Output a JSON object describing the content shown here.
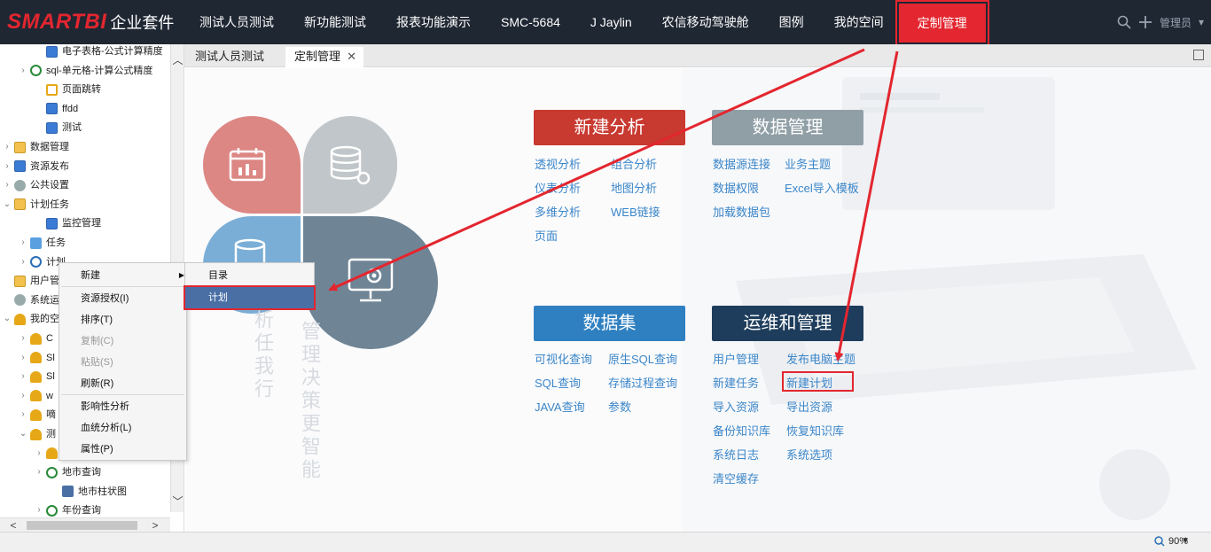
{
  "brand": {
    "name": "SMARTBI",
    "suite": "企业套件"
  },
  "nav": [
    "测试人员测试",
    "新功能测试",
    "报表功能演示",
    "SMC-5684",
    "J Jaylin",
    "农信移动驾驶舱",
    "图例",
    "我的空间",
    "定制管理"
  ],
  "user": {
    "label": "管理员"
  },
  "tree": [
    {
      "label": "电子表格-公式计算精度",
      "icon": "sheet-icon",
      "indent": 2,
      "arrow": ""
    },
    {
      "label": "sql-单元格-计算公式精度",
      "icon": "search-icon",
      "indent": 1,
      "arrow": ">"
    },
    {
      "label": "页面跳转",
      "icon": "page-icon",
      "indent": 2,
      "arrow": ""
    },
    {
      "label": "ffdd",
      "icon": "sheet-icon",
      "indent": 2,
      "arrow": ""
    },
    {
      "label": "测试",
      "icon": "sheet-icon",
      "indent": 2,
      "arrow": ""
    },
    {
      "label": "数据管理",
      "icon": "folder-icon",
      "indent": 0,
      "arrow": ">"
    },
    {
      "label": "资源发布",
      "icon": "sheet-icon",
      "indent": 0,
      "arrow": ">"
    },
    {
      "label": "公共设置",
      "icon": "gear-icon",
      "indent": 0,
      "arrow": ">"
    },
    {
      "label": "计划任务",
      "icon": "folder-icon",
      "indent": 0,
      "arrow": "v"
    },
    {
      "label": "监控管理",
      "icon": "sheet-icon",
      "indent": 2,
      "arrow": ""
    },
    {
      "label": "任务",
      "icon": "task-icon",
      "indent": 1,
      "arrow": ">"
    },
    {
      "label": "计划",
      "icon": "clock-icon",
      "indent": 1,
      "arrow": ">"
    },
    {
      "label": "用户管",
      "icon": "folder-icon",
      "indent": 0,
      "arrow": ""
    },
    {
      "label": "系统运",
      "icon": "gear-icon",
      "indent": 0,
      "arrow": ""
    },
    {
      "label": "我的空",
      "icon": "user-icon",
      "indent": 0,
      "arrow": "v"
    },
    {
      "label": "C",
      "icon": "user-icon",
      "indent": 1,
      "arrow": ">"
    },
    {
      "label": "Sl",
      "icon": "user-icon",
      "indent": 1,
      "arrow": ">"
    },
    {
      "label": "Sl",
      "icon": "user-icon",
      "indent": 1,
      "arrow": ">"
    },
    {
      "label": "w",
      "icon": "user-icon",
      "indent": 1,
      "arrow": ">"
    },
    {
      "label": "嘀",
      "icon": "user-icon",
      "indent": 1,
      "arrow": ">"
    },
    {
      "label": "测",
      "icon": "user-icon",
      "indent": 1,
      "arrow": "v"
    },
    {
      "label": "",
      "icon": "user-icon",
      "indent": 2,
      "arrow": ">"
    },
    {
      "label": "地市查询",
      "icon": "search-icon",
      "indent": 2,
      "arrow": ">"
    },
    {
      "label": "地市柱状图",
      "icon": "chart-icon",
      "indent": 3,
      "arrow": ""
    },
    {
      "label": "年份查询",
      "icon": "search-icon",
      "indent": 2,
      "arrow": ">"
    }
  ],
  "tabs": [
    {
      "label": "测试人员测试"
    },
    {
      "label": "定制管理",
      "close": "✕"
    }
  ],
  "context_menu": {
    "items": [
      "新建",
      "资源授权(I)",
      "排序(T)",
      "复制(C)",
      "粘贴(S)",
      "刷新(R)",
      "影响性分析",
      "血统分析(L)",
      "属性(P)"
    ],
    "submenu": [
      "目录",
      "计划"
    ]
  },
  "vertical_text": [
    "析任我行",
    "管理决策更智能"
  ],
  "categories": {
    "new_analysis": {
      "title": "新建分析",
      "color": "#c8392f",
      "links": [
        "透视分析",
        "组合分析",
        "仪表分析",
        "地图分析",
        "多维分析",
        "WEB链接",
        "页面"
      ]
    },
    "data_management": {
      "title": "数据管理",
      "color": "#909fa6",
      "links": [
        "数据源连接",
        "业务主题",
        "数据权限",
        "Excel导入模板",
        "加载数据包"
      ]
    },
    "dataset": {
      "title": "数据集",
      "color": "#2f80c1",
      "links": [
        "可视化查询",
        "原生SQL查询",
        "SQL查询",
        "存储过程查询",
        "JAVA查询",
        "参数"
      ]
    },
    "ops": {
      "title": "运维和管理",
      "color": "#1e3d5c",
      "links": [
        "用户管理",
        "发布电脑主题",
        "新建任务",
        "新建计划",
        "导入资源",
        "导出资源",
        "备份知识库",
        "恢复知识库",
        "系统日志",
        "系统选项",
        "清空缓存"
      ]
    }
  },
  "status": {
    "zoom": "90%"
  }
}
